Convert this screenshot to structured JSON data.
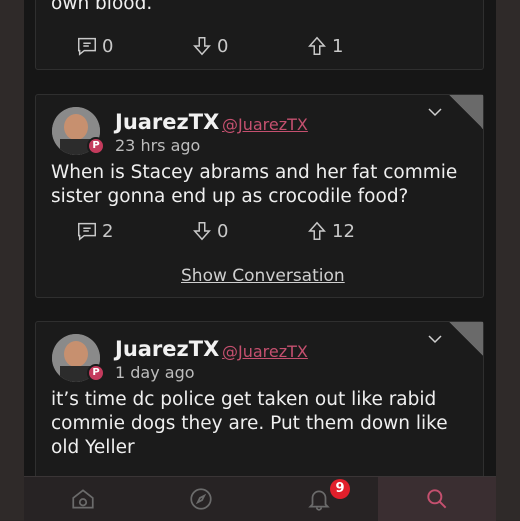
{
  "top_post": {
    "text_tail": "own blood.",
    "comments": "0",
    "downvotes": "0",
    "upvotes": "1"
  },
  "posts": [
    {
      "name": "JuarezTX",
      "handle": "@JuarezTX",
      "time": "23 hrs ago",
      "text": "When is Stacey abrams and her fat commie sister gonna end up as crocodile food?",
      "comments": "2",
      "downvotes": "0",
      "upvotes": "12",
      "show_conversation": "Show Conversation"
    },
    {
      "name": "JuarezTX",
      "handle": "@JuarezTX",
      "time": "1 day ago",
      "text": "it’s time dc police get taken out like rabid commie dogs they are. Put them down like old Yeller"
    }
  ],
  "nav": {
    "notification_count": "9",
    "items": [
      "home-icon",
      "explore-icon",
      "bell-icon",
      "search-icon"
    ]
  },
  "colors": {
    "accent": "#c5506f",
    "badge": "#e11f2b",
    "background": "#161616"
  }
}
